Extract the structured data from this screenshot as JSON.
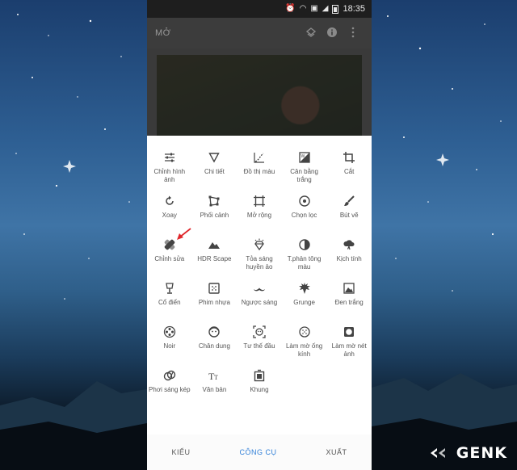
{
  "status_bar": {
    "time": "18:35"
  },
  "app_bar": {
    "title": "MỞ"
  },
  "tools": [
    {
      "label": "Chỉnh hình ảnh",
      "icon": "tune-icon"
    },
    {
      "label": "Chi tiết",
      "icon": "details-triangle-icon"
    },
    {
      "label": "Đồ thị màu",
      "icon": "curves-icon"
    },
    {
      "label": "Cân bằng trắng",
      "icon": "white-balance-icon"
    },
    {
      "label": "Cắt",
      "icon": "crop-icon"
    },
    {
      "label": "Xoay",
      "icon": "rotate-icon"
    },
    {
      "label": "Phối cảnh",
      "icon": "perspective-icon"
    },
    {
      "label": "Mở rộng",
      "icon": "expand-icon"
    },
    {
      "label": "Chọn lọc",
      "icon": "selective-icon"
    },
    {
      "label": "Bút vẽ",
      "icon": "brush-icon"
    },
    {
      "label": "Chỉnh sửa",
      "icon": "healing-bandage-icon"
    },
    {
      "label": "HDR Scape",
      "icon": "mountain-icon"
    },
    {
      "label": "Tỏa sáng huyền ảo",
      "icon": "glamour-glow-icon"
    },
    {
      "label": "T.phản tông màu",
      "icon": "tonal-contrast-icon"
    },
    {
      "label": "Kịch tính",
      "icon": "drama-cloud-icon"
    },
    {
      "label": "Cổ điển",
      "icon": "vintage-lamp-icon"
    },
    {
      "label": "Phim nhựa",
      "icon": "grainy-film-icon"
    },
    {
      "label": "Ngược sáng",
      "icon": "retrolux-mustache-icon"
    },
    {
      "label": "Grunge",
      "icon": "grunge-icon"
    },
    {
      "label": "Đen trắng",
      "icon": "black-white-icon"
    },
    {
      "label": "Noir",
      "icon": "film-reel-icon"
    },
    {
      "label": "Chân dung",
      "icon": "portrait-face-icon"
    },
    {
      "label": "Tư thế đầu",
      "icon": "head-pose-icon"
    },
    {
      "label": "Làm mờ ống kính",
      "icon": "lens-blur-icon"
    },
    {
      "label": "Làm mờ nét ảnh",
      "icon": "vignette-icon"
    },
    {
      "label": "Phơi sáng kép",
      "icon": "double-exposure-icon"
    },
    {
      "label": "Văn bản",
      "icon": "text-icon"
    },
    {
      "label": "Khung",
      "icon": "frames-icon"
    }
  ],
  "bottom_tabs": [
    {
      "label": "KIỂU",
      "active": false
    },
    {
      "label": "CÔNG CỤ",
      "active": true
    },
    {
      "label": "XUẤT",
      "active": false
    }
  ],
  "watermark": {
    "text": "GENK"
  },
  "colors": {
    "accent": "#2f7fd8",
    "arrow": "#e0262b"
  }
}
